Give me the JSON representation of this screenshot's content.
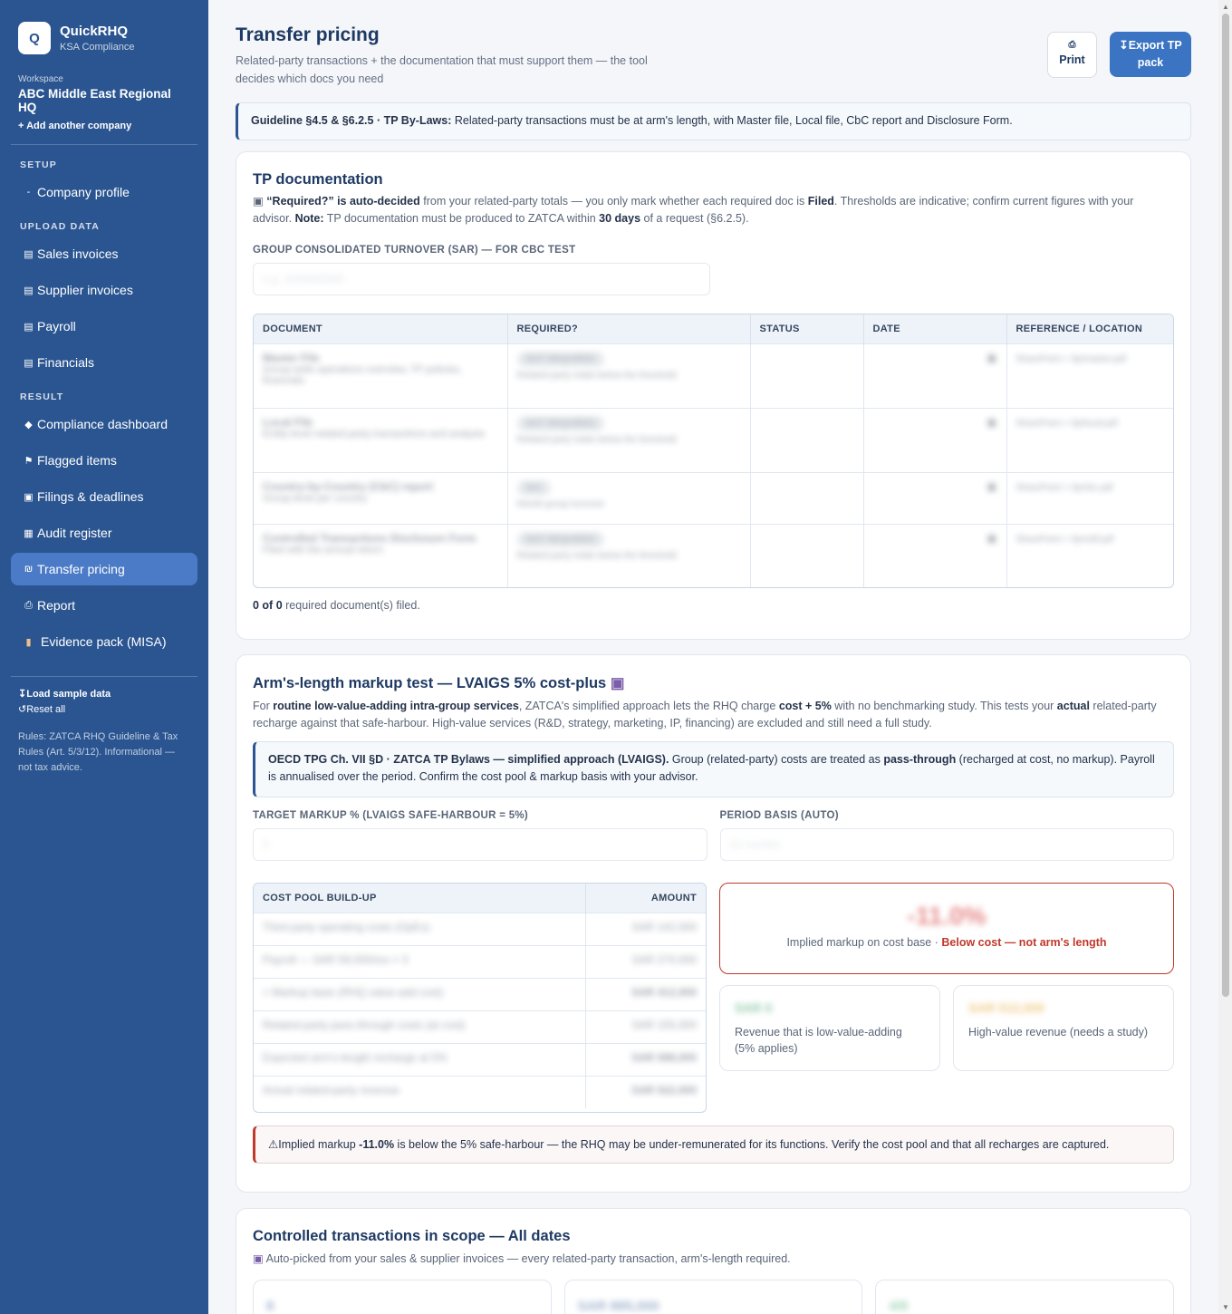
{
  "brand": {
    "logo_letter": "Q",
    "name": "QuickRHQ",
    "sub": "KSA Compliance"
  },
  "workspace": {
    "label": "Workspace",
    "name": "ABC Middle East Regional HQ",
    "add": "+ Add another company"
  },
  "nav": {
    "setup_title": "SETUP",
    "company_profile": "Company profile",
    "upload_title": "UPLOAD DATA",
    "sales": "Sales invoices",
    "supplier": "Supplier invoices",
    "payroll": "Payroll",
    "financials": "Financials",
    "result_title": "RESULT",
    "dashboard": "Compliance dashboard",
    "flagged": "Flagged items",
    "filings": "Filings & deadlines",
    "audit": "Audit register",
    "tp": "Transfer pricing",
    "report": "Report",
    "evidence": "Evidence pack (MISA)"
  },
  "sidebar_footer": {
    "load_sample": "Load sample data",
    "reset": "Reset all",
    "disclaimer": "Rules: ZATCA RHQ Guideline & Tax Rules (Art. 5/3/12). Informational — not tax advice."
  },
  "header": {
    "title": "Transfer pricing",
    "subtitle": "Related-party transactions + the documentation that must support them — the tool decides which docs you need",
    "print": "Print",
    "export": "Export TP pack"
  },
  "guideline": {
    "strong": "Guideline §4.5 & §6.2.5 · TP By-Laws:",
    "text": " Related-party transactions must be at arm's length, with Master file, Local file, CbC report and Disclosure Form."
  },
  "tp_docs": {
    "title": "TP documentation",
    "desc_a": "“Required?” is auto-decided",
    "desc_b": " from your related-party totals — you only mark whether each required doc is ",
    "desc_c": "Filed",
    "desc_d": ". Thresholds are indicative; confirm current figures with your advisor. ",
    "desc_e": "Note:",
    "desc_f": " TP documentation must be produced to ZATCA within ",
    "desc_g": "30 days",
    "desc_h": " of a request (§6.2.5).",
    "turnover_label": "GROUP CONSOLIDATED TURNOVER (SAR) — FOR CBC TEST",
    "turnover_placeholder": "e.g. 3200000000",
    "columns": [
      "DOCUMENT",
      "REQUIRED?",
      "STATUS",
      "DATE",
      "REFERENCE / LOCATION"
    ],
    "rows": [
      {
        "doc": "Master File",
        "sub": "Group-wide operations overview, TP policies, financials",
        "req": "NOT REQUIRED",
        "req_sub": "Related-party totals below the threshold",
        "ref": "SharePoint > /tp/master.pdf"
      },
      {
        "doc": "Local File",
        "sub": "Entity-level related-party transactions and analysis",
        "req": "NOT REQUIRED",
        "req_sub": "Related-party totals below the threshold",
        "ref": "SharePoint > /tp/local.pdf"
      },
      {
        "doc": "Country-by-Country (CbC) report",
        "sub": "Group-level per country",
        "req": "N/A",
        "req_sub": "Needs group turnover",
        "ref": "SharePoint > /tp/cbc.pdf"
      },
      {
        "doc": "Controlled Transactions Disclosure Form",
        "sub": "Filed with the annual return",
        "req": "NOT REQUIRED",
        "req_sub": "Related-party totals below the threshold",
        "ref": "SharePoint > /tp/ctdf.pdf"
      }
    ],
    "filed_count": "0 of 0",
    "filed_text": " required document(s) filed."
  },
  "markup": {
    "title": "Arm's-length markup test — LVAIGS 5% cost-plus",
    "desc_1": "For ",
    "desc_2": "routine low-value-adding intra-group services",
    "desc_3": ", ZATCA's simplified approach lets the RHQ charge ",
    "desc_4": "cost + 5%",
    "desc_5": " with no benchmarking study. This tests your ",
    "desc_6": "actual",
    "desc_7": " related-party recharge against that safe-harbour. High-value services (R&D, strategy, marketing, IP, financing) are excluded and still need a full study.",
    "note_strong": "OECD TPG Ch. VII §D · ZATCA TP Bylaws — simplified approach (LVAIGS).",
    "note_1": " Group (related-party) costs are treated as ",
    "note_2": "pass-through",
    "note_3": " (recharged at cost, no markup). Payroll is annualised over the period. Confirm the cost pool & markup basis with your advisor.",
    "target_label": "TARGET MARKUP % (LVAIGS SAFE-HARBOUR = 5%)",
    "target_value": "5",
    "period_label": "PERIOD BASIS (AUTO)",
    "period_value": "12 months",
    "cost_header": "COST POOL BUILD-UP",
    "amount_header": "AMOUNT",
    "cost_rows": [
      {
        "label": "Third-party operating costs (OpEx)",
        "amount": "SAR 142,000"
      },
      {
        "label": "Payroll — SAR 59,000/mo × 3",
        "amount": "SAR 270,000"
      },
      {
        "label": "= Markup base (RHQ value-add cost)",
        "amount": "SAR 412,000"
      },
      {
        "label": "Related-party pass-through costs (at cost)",
        "amount": "SAR 155,000"
      },
      {
        "label": "Expected arm's-length recharge at 5%",
        "amount": "SAR 588,000"
      },
      {
        "label": "Actual related-party revenue",
        "amount": "SAR 522,000"
      }
    ],
    "implied_value": "-11.0%",
    "implied_label": "Implied markup on cost base · ",
    "implied_status": "Below cost — not arm's length",
    "low_value_amount": "SAR 0",
    "low_value_label": "Revenue that is low-value-adding (5% applies)",
    "high_value_amount": "SAR 512,000",
    "high_value_label": "High-value revenue (needs a study)",
    "warning_1": "Implied markup ",
    "warning_2": "-11.0%",
    "warning_3": " is below the 5% safe-harbour — the RHQ may be under-remunerated for its functions. Verify the cost pool and that all recharges are captured."
  },
  "controlled": {
    "title": "Controlled transactions in scope — All dates",
    "desc": "Auto-picked from your sales & supplier invoices — every related-party transaction, arm's-length required.",
    "stat_1": "8",
    "stat_2": "SAR 885,000",
    "stat_3": "4/8"
  }
}
